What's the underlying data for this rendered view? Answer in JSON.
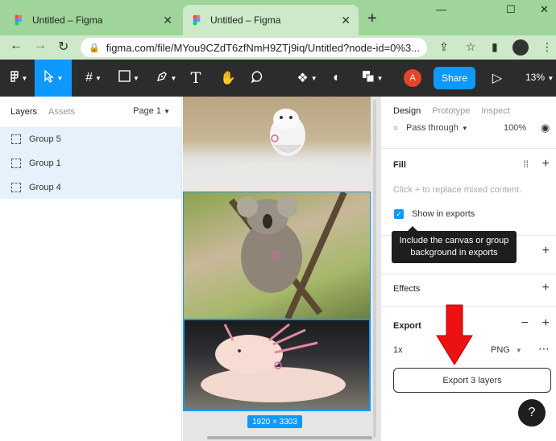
{
  "browser": {
    "tabs": [
      {
        "title": "Untitled – Figma",
        "active": false
      },
      {
        "title": "Untitled – Figma",
        "active": true
      }
    ],
    "new_tab_label": "+",
    "window_controls": {
      "minimize": "—",
      "maximize": "☐",
      "close": "✕"
    },
    "url": "figma.com/file/MYou9CZdT6zfNmH9ZTj9iq/Untitled?node-id=0%3...",
    "colors": {
      "tabstrip": "#9fd59a",
      "active_tab": "#cde9c9"
    }
  },
  "toolbar": {
    "zoom": "13%",
    "share_label": "Share",
    "user_initial": "A",
    "text_tool_glyph": "T",
    "colors": {
      "bg": "#2c2c2c",
      "accent": "#0d99ff",
      "avatar": "#e5452b"
    }
  },
  "left_panel": {
    "tabs": [
      {
        "label": "Layers",
        "active": true
      },
      {
        "label": "Assets",
        "active": false
      }
    ],
    "page_selector": "Page 1",
    "layers": [
      "Group 5",
      "Group 1",
      "Group 4"
    ]
  },
  "canvas": {
    "frames": [
      "owl",
      "koala",
      "axolotl"
    ],
    "dimension_label": "1920 × 3303"
  },
  "right_panel": {
    "tabs": [
      {
        "label": "Design",
        "active": true
      },
      {
        "label": "Prototype",
        "active": false
      },
      {
        "label": "Inspect",
        "active": false
      }
    ],
    "layer": {
      "blend_mode": "Pass through",
      "opacity": "100%"
    },
    "fill": {
      "title": "Fill",
      "hint": "Click + to replace mixed content.",
      "show_in_exports_label": "Show in exports",
      "show_in_exports_checked": true,
      "tooltip": "Include the canvas or group background in exports"
    },
    "effects_title": "Effects",
    "export": {
      "title": "Export",
      "scale": "1x",
      "format": "PNG",
      "button_label": "Export 3 layers"
    }
  },
  "help_label": "?"
}
